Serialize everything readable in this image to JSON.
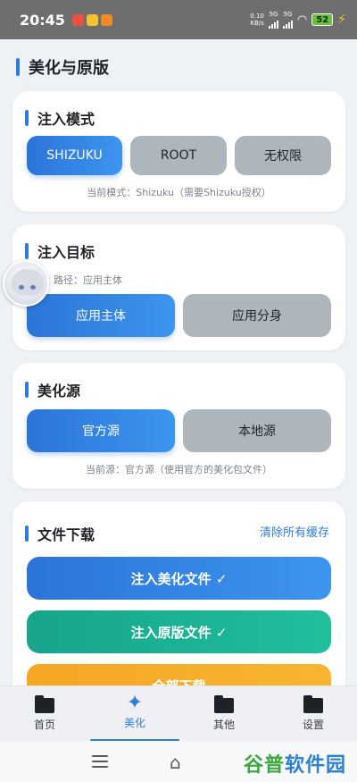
{
  "status_bar": {
    "time": "20:45",
    "net_speed_value": "0.10",
    "net_speed_unit": "KB/s",
    "sim1": "5G",
    "sim2": "5G",
    "battery": "52"
  },
  "page": {
    "title": "美化与原版"
  },
  "inject_mode": {
    "title": "注入模式",
    "options": [
      "SHIZUKU",
      "ROOT",
      "无权限"
    ],
    "selected": "SHIZUKU",
    "hint": "当前模式：Shizuku（需要Shizuku授权）"
  },
  "inject_target": {
    "title": "注入目标",
    "path_hint": "路径：应用主体",
    "options": [
      "应用主体",
      "应用分身"
    ],
    "selected": "应用主体"
  },
  "beautify_source": {
    "title": "美化源",
    "options": [
      "官方源",
      "本地源"
    ],
    "selected": "官方源",
    "hint": "当前源：官方源（使用官方的美化包文件）"
  },
  "file_download": {
    "title": "文件下载",
    "clear_cache": "清除所有缓存",
    "buttons": [
      "注入美化文件 ✓",
      "注入原版文件 ✓",
      "全部下载"
    ]
  },
  "bottom_nav": {
    "items": [
      "首页",
      "美化",
      "其他",
      "设置"
    ],
    "active": "美化"
  },
  "watermark": {
    "part1": "谷普",
    "part2": "软件园"
  },
  "colors": {
    "accent": "#2e7be0",
    "teal": "#1aa98f",
    "orange": "#f6a623",
    "inactive": "#aeb6bd"
  }
}
